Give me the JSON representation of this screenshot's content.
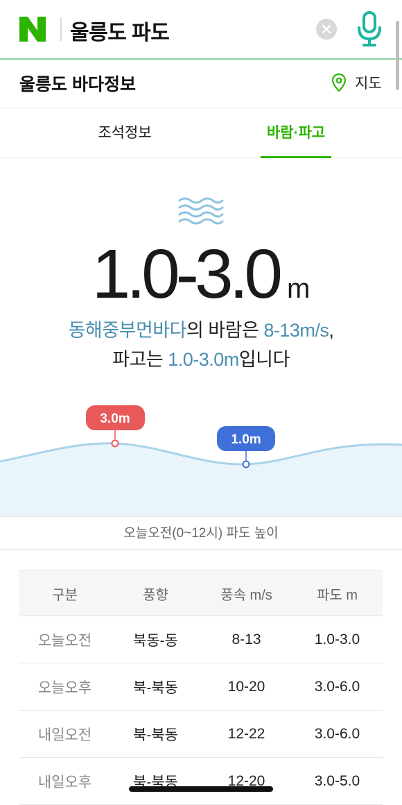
{
  "search": {
    "query": "울릉도 파도",
    "logo_letter": "N",
    "icons": {
      "clear": "clear-icon",
      "mic": "microphone-icon"
    }
  },
  "header": {
    "title": "울릉도 바다정보",
    "map_label": "지도",
    "map_icon": "location-pin-icon"
  },
  "tabs": [
    {
      "label": "조석정보",
      "active": false
    },
    {
      "label": "바람·파고",
      "active": true
    }
  ],
  "hero": {
    "wave_icon": "waves-icon",
    "height_value": "1.0-3.0",
    "height_unit": "m",
    "sea_area": "동해중부먼바다",
    "text_part1": "의 바람은 ",
    "wind_speed": "8-13m/s",
    "text_part2": ",",
    "text_part3": "파고는 ",
    "wave_height": "1.0-3.0m",
    "text_part4": "입니다"
  },
  "chart_data": {
    "type": "area",
    "max_label": "3.0m",
    "min_label": "1.0m",
    "max_value": 3.0,
    "min_value": 1.0,
    "caption": "오늘오전(0~12시) 파도 높이"
  },
  "table": {
    "headers": [
      "구분",
      "풍향",
      "풍속 m/s",
      "파도 m"
    ],
    "rows": [
      [
        "오늘오전",
        "북동-동",
        "8-13",
        "1.0-3.0"
      ],
      [
        "오늘오후",
        "북-북동",
        "10-20",
        "3.0-6.0"
      ],
      [
        "내일오전",
        "북-북동",
        "12-22",
        "3.0-6.0"
      ],
      [
        "내일오후",
        "북-북동",
        "12-20",
        "3.0-5.0"
      ]
    ]
  },
  "colors": {
    "brand_green": "#2db400",
    "highlight_blue": "#4a8fb0",
    "max_badge": "#e85a5a",
    "min_badge": "#3f6fd8",
    "wave_fill": "#eaf5fb"
  }
}
